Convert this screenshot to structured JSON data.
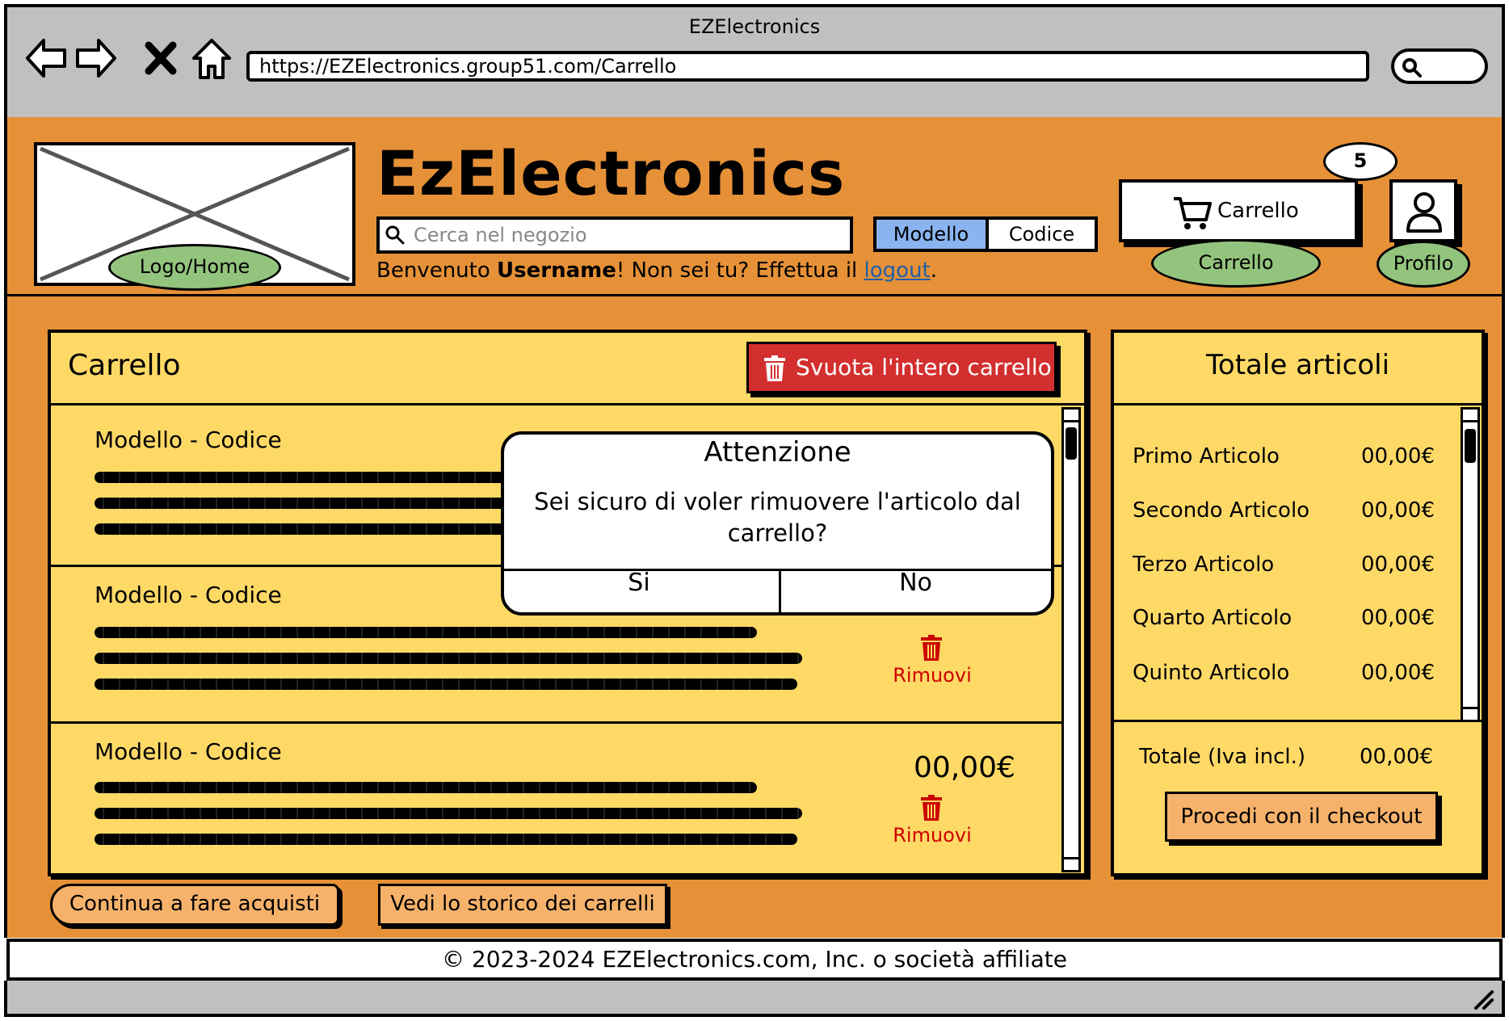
{
  "browser": {
    "title": "EZElectronics",
    "url": "https://EZElectronics.group51.com/Carrello"
  },
  "header": {
    "brand": "EzElectronics",
    "logo_label": "Logo/Home",
    "search_placeholder": "Cerca nel negozio",
    "search_modes": [
      "Modello",
      "Codice"
    ],
    "welcome_prefix": "Benvenuto ",
    "username": "Username",
    "welcome_middle": "! Non sei tu? Effettua il ",
    "logout": "logout",
    "welcome_suffix": ".",
    "cart_button": "Carrello",
    "cart_count": "5",
    "cart_link": "Carrello",
    "profile_link": "Profilo"
  },
  "cart": {
    "title": "Carrello",
    "empty_button": "Svuota l'intero carrello",
    "items": [
      {
        "title": "Modello - Codice",
        "price": "",
        "remove": ""
      },
      {
        "title": "Modello - Codice",
        "price": "",
        "remove": "Rimuovi"
      },
      {
        "title": "Modello - Codice",
        "price": "00,00€",
        "remove": "Rimuovi"
      }
    ]
  },
  "totals": {
    "title": "Totale articoli",
    "articles": [
      {
        "name": "Primo Articolo",
        "price": "00,00€"
      },
      {
        "name": "Secondo Articolo",
        "price": "00,00€"
      },
      {
        "name": "Terzo Articolo",
        "price": "00,00€"
      },
      {
        "name": "Quarto Articolo",
        "price": "00,00€"
      },
      {
        "name": "Quinto Articolo",
        "price": "00,00€"
      }
    ],
    "total_label": "Totale (Iva incl.)",
    "total_value": "00,00€",
    "checkout": "Procedi con il checkout"
  },
  "actions": {
    "continue": "Continua a fare acquisti",
    "history": "Vedi lo storico dei carrelli"
  },
  "modal": {
    "title": "Attenzione",
    "message": "Sei sicuro di voler rimuovere l'articolo dal carrello?",
    "yes": "Si",
    "no": "No"
  },
  "footer": {
    "copyright": "© 2023-2024 EZElectronics.com, Inc. o società affiliate"
  },
  "colors": {
    "page_bg": "#e69138",
    "panel_bg": "#ffd966",
    "danger": "#d32f2f",
    "accent_button": "#f6b26b",
    "nav_pill": "#93c47d",
    "selected_segment": "#8ab4f0"
  }
}
